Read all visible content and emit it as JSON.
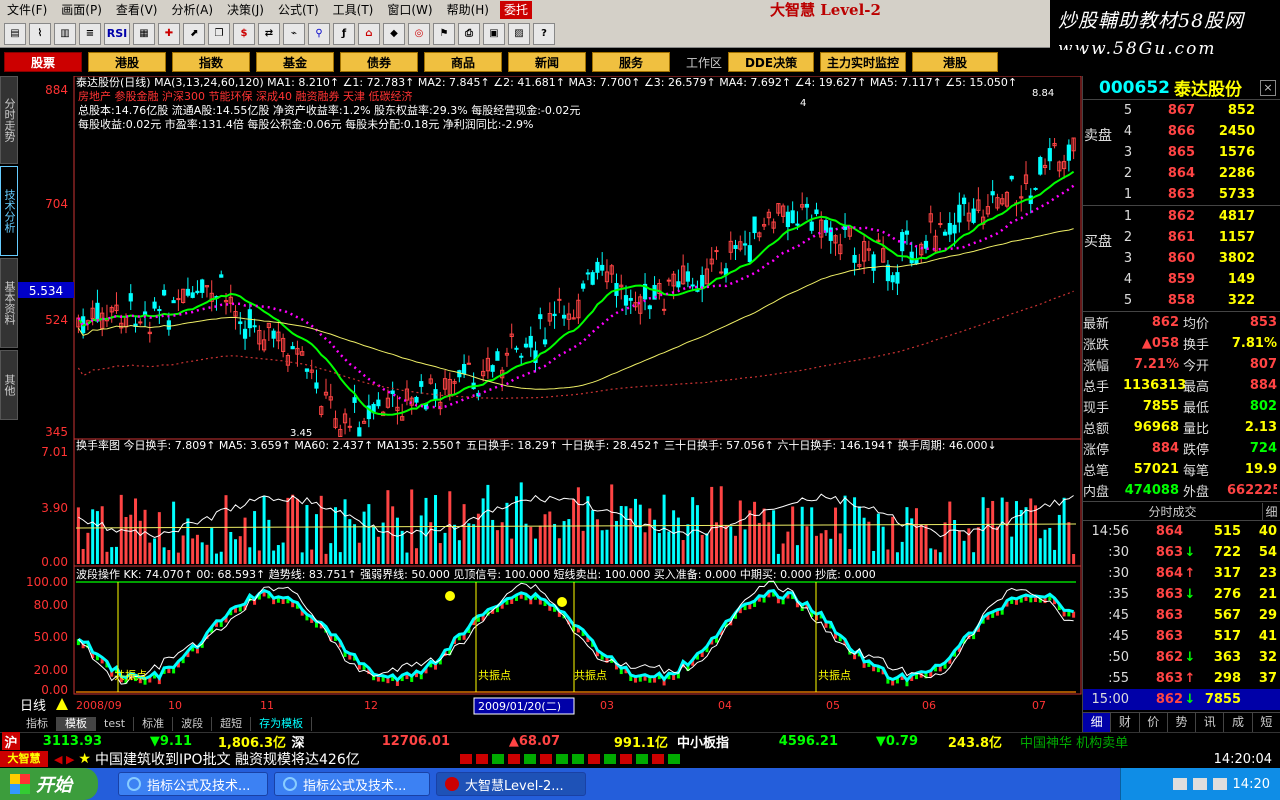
{
  "menu": {
    "items": [
      "文件(F)",
      "画面(P)",
      "查看(V)",
      "分析(A)",
      "决策(J)",
      "公式(T)",
      "工具(T)",
      "窗口(W)",
      "帮助(H)"
    ],
    "entrust": "委托",
    "brand": "大智慧 Level-2"
  },
  "watermark": {
    "line1": "炒股輔助教材58股网",
    "line2": "www.58Gu.com"
  },
  "toolbar": {
    "rsi": "RSI"
  },
  "nav": {
    "buttons": [
      "股票",
      "港股",
      "指数",
      "基金",
      "债券",
      "商品",
      "新闻",
      "服务"
    ],
    "workarea_label": "工作区",
    "right_buttons": [
      "DDE决策",
      "主力实时监控",
      "港股"
    ]
  },
  "left_tabs": [
    "分时走势",
    "技术分析",
    "基本资料",
    "其他"
  ],
  "main_chart": {
    "header": "泰达股份(日线)  MA(3,13,24,60,120)  MA1: 8.210↑  ∠1: 72.783↑  MA2: 7.845↑  ∠2: 41.681↑  MA3: 7.700↑  ∠3: 26.579↑  MA4: 7.692↑  ∠4: 19.627↑  MA5: 7.117↑  ∠5: 15.050↑",
    "tags": "房地产 参股金融 沪深300 节能环保 深成40 融资融券 天津 低碳经济",
    "info1": "总股本:14.76亿股  流通A股:14.55亿股  净资产收益率:1.2%  股东权益率:29.3%  每股经营现金:-0.02元",
    "info2": "每股收益:0.02元  市盈率:131.4倍  每股公积金:0.06元  每股未分配:0.18元  净利润同比:-2.9%",
    "y_labels": [
      "884",
      "704",
      "524",
      "345"
    ],
    "cursor_label": "5.534",
    "annot_high": "8.84",
    "annot_low": "3.45",
    "annot_4": "4"
  },
  "volume_chart": {
    "header": "换手率图  今日换手: 7.809↑  MA5: 3.659↑  MA60: 2.437↑  MA135: 2.550↑  五日换手: 18.29↑  十日换手: 28.452↑  三十日换手: 57.056↑  六十日换手: 146.194↑  换手周期: 46.000↓",
    "y_labels": [
      "7.01",
      "3.90",
      "0.00"
    ]
  },
  "wave_chart": {
    "header": "波段操作  KK: 74.070↑  00: 68.593↑  趋势线: 83.751↑  强弱界线: 50.000  见顶信号: 100.000  短线卖出: 100.000  买入准备: 0.000  中期买: 0.000  抄底: 0.000",
    "y_labels": [
      "100.00",
      "80.00",
      "50.00",
      "20.00",
      "0.00"
    ],
    "resonance": "共振点"
  },
  "x_axis": {
    "period": "日线",
    "labels": [
      "2008/09",
      "10",
      "11",
      "12",
      "2009/01/20(二)",
      "03",
      "04",
      "05",
      "06",
      "07"
    ]
  },
  "quote": {
    "code": "000652",
    "name": "泰达股份",
    "close_icon": "×",
    "sell_side": "卖盘",
    "buy_side": "买盘",
    "asks": [
      {
        "lvl": "5",
        "price": "867",
        "vol": "852"
      },
      {
        "lvl": "4",
        "price": "866",
        "vol": "2450"
      },
      {
        "lvl": "3",
        "price": "865",
        "vol": "1576"
      },
      {
        "lvl": "2",
        "price": "864",
        "vol": "2286"
      },
      {
        "lvl": "1",
        "price": "863",
        "vol": "5733"
      }
    ],
    "bids": [
      {
        "lvl": "1",
        "price": "862",
        "vol": "4817"
      },
      {
        "lvl": "2",
        "price": "861",
        "vol": "1157"
      },
      {
        "lvl": "3",
        "price": "860",
        "vol": "3802"
      },
      {
        "lvl": "4",
        "price": "859",
        "vol": "149"
      },
      {
        "lvl": "5",
        "price": "858",
        "vol": "322"
      }
    ],
    "stats": [
      {
        "l1": "最新",
        "v1": "862",
        "c1": "#f44",
        "l2": "均价",
        "v2": "853",
        "c2": "#f44"
      },
      {
        "l1": "涨跌",
        "v1": "▲058",
        "c1": "#f44",
        "l2": "换手",
        "v2": "7.81%",
        "c2": "#ff0"
      },
      {
        "l1": "涨幅",
        "v1": "7.21%",
        "c1": "#f44",
        "l2": "今开",
        "v2": "807",
        "c2": "#f44"
      },
      {
        "l1": "总手",
        "v1": "1136313",
        "c1": "#ff0",
        "l2": "最高",
        "v2": "884",
        "c2": "#f44"
      },
      {
        "l1": "现手",
        "v1": "7855",
        "c1": "#ff0",
        "l2": "最低",
        "v2": "802",
        "c2": "#0f0"
      },
      {
        "l1": "总额",
        "v1": "96968",
        "c1": "#ff0",
        "l2": "量比",
        "v2": "2.13",
        "c2": "#ff0"
      },
      {
        "l1": "涨停",
        "v1": "884",
        "c1": "#f44",
        "l2": "跌停",
        "v2": "724",
        "c2": "#0f0"
      },
      {
        "l1": "总笔",
        "v1": "57021",
        "c1": "#ff0",
        "l2": "每笔",
        "v2": "19.9",
        "c2": "#ff0"
      },
      {
        "l1": "内盘",
        "v1": "474088",
        "c1": "#0f0",
        "l2": "外盘",
        "v2": "662225",
        "c2": "#f44"
      }
    ],
    "ticks_title": "分时成交",
    "ticks_btn": "细",
    "ticks": [
      {
        "t": "14:56",
        "p": "864",
        "a": "",
        "v": "515",
        "n": "40",
        "c": "#f44"
      },
      {
        "t": ":30",
        "p": "863",
        "a": "↓",
        "v": "722",
        "n": "54",
        "c": "#f44"
      },
      {
        "t": ":30",
        "p": "864",
        "a": "↑",
        "v": "317",
        "n": "23",
        "c": "#f44"
      },
      {
        "t": ":35",
        "p": "863",
        "a": "↓",
        "v": "276",
        "n": "21",
        "c": "#f44"
      },
      {
        "t": ":45",
        "p": "863",
        "a": "",
        "v": "567",
        "n": "29",
        "c": "#f44"
      },
      {
        "t": ":45",
        "p": "863",
        "a": "",
        "v": "517",
        "n": "41",
        "c": "#f44"
      },
      {
        "t": ":50",
        "p": "862",
        "a": "↓",
        "v": "363",
        "n": "32",
        "c": "#f44"
      },
      {
        "t": ":55",
        "p": "863",
        "a": "↑",
        "v": "298",
        "n": "37",
        "c": "#f44"
      }
    ],
    "last_tick": {
      "t": "15:00",
      "p": "862",
      "a": "↓",
      "v": "7855"
    },
    "tabs": [
      "细",
      "财",
      "价",
      "势",
      "讯",
      "成",
      "短"
    ]
  },
  "bottom_tabs": [
    "指标",
    "模板",
    "test",
    "标准",
    "波段",
    "超短",
    "存为模板"
  ],
  "index_bar": {
    "sh_label": "沪",
    "sh_value": "3113.93",
    "sh_change": "▼9.11",
    "sh_amount": "1,806.3亿",
    "sz_label": "深",
    "sz_value": "12706.01",
    "sz_change": "▲68.07",
    "sz_amount": "991.1亿",
    "sme_label": "中小板指",
    "sme_value": "4596.21",
    "sme_change": "▼0.79",
    "sme_amount": "243.8亿",
    "right_note": "中国神华 机构卖单"
  },
  "news": {
    "logo": "大智慧",
    "arrows": "◀ ▶",
    "star": "★",
    "text": "中国建筑收到IPO批文 融资规模将达426亿",
    "clock": "14:20:04"
  },
  "taskbar": {
    "start": "开始",
    "tasks": [
      "指标公式及技术...",
      "指标公式及技术...",
      "大智慧Level-2..."
    ],
    "time": "14:20"
  },
  "colors": {
    "up": "#ff4444",
    "down": "#00ff00",
    "accent": "#ffff00",
    "nav": "#f0c040"
  }
}
